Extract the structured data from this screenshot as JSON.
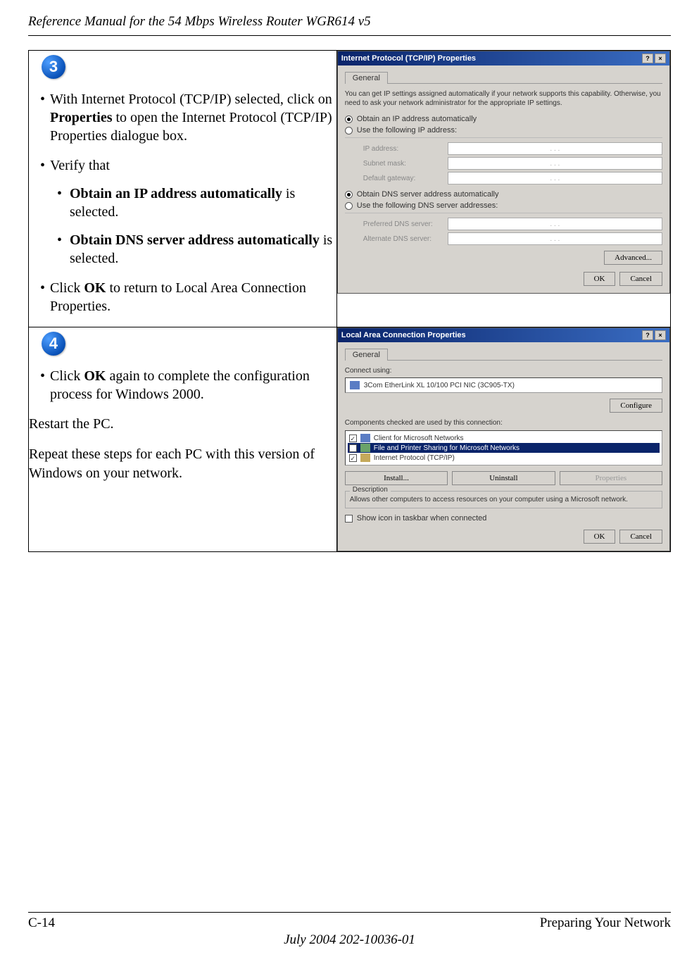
{
  "header": {
    "title": "Reference Manual for the 54 Mbps Wireless Router WGR614 v5"
  },
  "step3": {
    "badge": "3",
    "bullets": {
      "b1_pre": "With Internet Protocol (TCP/IP) selected, click on ",
      "b1_strong": "Properties",
      "b1_post": " to open the Internet Protocol (TCP/IP) Properties dialogue box.",
      "b2": "Verify that",
      "b2_s1_strong": "Obtain an IP address automatically",
      "b2_s1_post": " is selected.",
      "b2_s2_strong": "Obtain DNS server address automatically",
      "b2_s2_post": " is selected.",
      "b3_pre": "Click ",
      "b3_strong": "OK",
      "b3_post": " to return to Local Area Connection Properties."
    },
    "dialog": {
      "title": "Internet Protocol (TCP/IP) Properties",
      "tab": "General",
      "intro": "You can get IP settings assigned automatically if your network supports this capability. Otherwise, you need to ask your network administrator for the appropriate IP settings.",
      "r1": "Obtain an IP address automatically",
      "r2": "Use the following IP address:",
      "f1": "IP address:",
      "f2": "Subnet mask:",
      "f3": "Default gateway:",
      "r3": "Obtain DNS server address automatically",
      "r4": "Use the following DNS server addresses:",
      "f4": "Preferred DNS server:",
      "f5": "Alternate DNS server:",
      "adv": "Advanced...",
      "ok": "OK",
      "cancel": "Cancel"
    }
  },
  "step4": {
    "badge": "4",
    "b1_pre": "Click ",
    "b1_strong": "OK",
    "b1_post": " again to complete the configuration process for Windows 2000.",
    "p1": "Restart the PC.",
    "p2": "Repeat these steps for each PC with this version of Windows on your network.",
    "dialog": {
      "title": "Local Area Connection Properties",
      "tab": "General",
      "connect_label": "Connect using:",
      "adapter": "3Com EtherLink XL 10/100 PCI NIC (3C905-TX)",
      "configure": "Configure",
      "components_label": "Components checked are used by this connection:",
      "c1": "Client for Microsoft Networks",
      "c2": "File and Printer Sharing for Microsoft Networks",
      "c3": "Internet Protocol (TCP/IP)",
      "install": "Install...",
      "uninstall": "Uninstall",
      "properties": "Properties",
      "desc_label": "Description",
      "desc": "Allows other computers to access resources on your computer using a Microsoft network.",
      "show_icon": "Show icon in taskbar when connected",
      "ok": "OK",
      "cancel": "Cancel"
    }
  },
  "footer": {
    "page": "C-14",
    "section": "Preparing Your Network",
    "date_doc": "July 2004 202-10036-01"
  }
}
